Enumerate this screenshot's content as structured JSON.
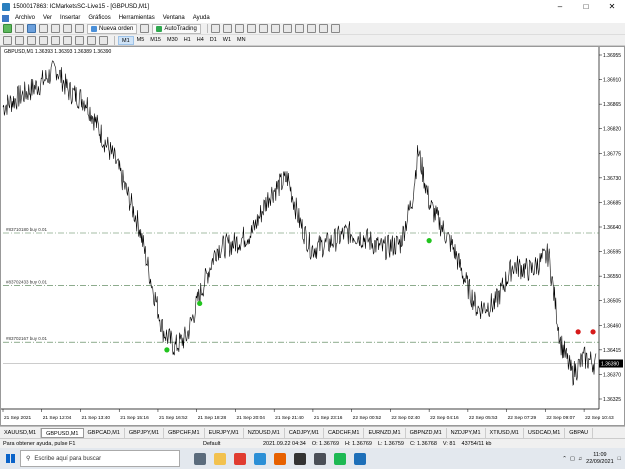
{
  "window": {
    "title": "1500017863: ICMarketsSC-Live15 - [GBPUSD,M1]"
  },
  "menu": [
    "Archivo",
    "Ver",
    "Insertar",
    "Gráficos",
    "Herramientas",
    "Ventana",
    "Ayuda"
  ],
  "toolbar": {
    "new_order": "Nueva orden",
    "autotrading": "AutoTrading"
  },
  "timeframes": [
    "M1",
    "M5",
    "M15",
    "M30",
    "H1",
    "H4",
    "D1",
    "W1",
    "MN"
  ],
  "chart_header": "GBPUSD,M1  1.36393 1.36393 1.36389 1.36390",
  "price_axis": [
    "1.36955",
    "1.36910",
    "1.36865",
    "1.36820",
    "1.36775",
    "1.36730",
    "1.36685",
    "1.36640",
    "1.36595",
    "1.36550",
    "1.36505",
    "1.36460",
    "1.36415",
    "1.36370",
    "1.36325"
  ],
  "current_price": "1.36390",
  "time_axis": [
    "21 Sep 2021",
    "21 Sep 12:04",
    "21 Sep 13:40",
    "21 Sep 15:16",
    "21 Sep 16:52",
    "21 Sep 18:28",
    "21 Sep 20:04",
    "21 Sep 21:40",
    "21 Sep 23:16",
    "22 Sep 00:52",
    "22 Sep 02:40",
    "22 Sep 04:16",
    "22 Sep 05:53",
    "22 Sep 07:29",
    "22 Sep 09:07",
    "22 Sep 10:43"
  ],
  "levels": [
    {
      "label": "#83710180 buy 0.01",
      "price": 1.36629
    },
    {
      "label": "#83702433 buy 0.01",
      "price": 1.36533
    },
    {
      "label": "#83702167 buy 0.01",
      "price": 1.36429
    }
  ],
  "markers": [
    {
      "color": "#22c41f",
      "time_index": 0.275,
      "price": 1.36415
    },
    {
      "color": "#22c41f",
      "time_index": 0.33,
      "price": 1.365
    },
    {
      "color": "#22c41f",
      "time_index": 0.715,
      "price": 1.36615
    },
    {
      "color": "#d61a1a",
      "time_index": 0.965,
      "price": 1.36448
    },
    {
      "color": "#d61a1a",
      "time_index": 0.99,
      "price": 1.36448
    }
  ],
  "tabs": [
    "XAUUSD,M1",
    "GBPUSD,M1",
    "GBPCAD,M1",
    "GBPJPY,M1",
    "GBPCHF,M1",
    "EURJPY,M1",
    "NZDUSD,M1",
    "CADJPY,M1",
    "CADCHF,M1",
    "EURNZD,M1",
    "GBPNZD,M1",
    "NZDJPY,M1",
    "XTIUSD,M1",
    "USDCAD,M1",
    "GBPAU"
  ],
  "status": {
    "help": "Para obtener ayuda, pulse F1",
    "profile": "Default",
    "datetime": "2021.09.22 04:34",
    "open": "O: 1.36769",
    "high": "H: 1.36769",
    "low": "L: 1.36759",
    "close": "C: 1.36768",
    "volume": "V: 81",
    "traffic": "43754/11 kb"
  },
  "taskbar": {
    "search_placeholder": "Escribe aquí para buscar",
    "time": "11:09",
    "date": "22/09/2021"
  },
  "colors": {
    "level_line": "#4a7a4a",
    "price_line": "#000000",
    "bg": "#ffffff"
  }
}
